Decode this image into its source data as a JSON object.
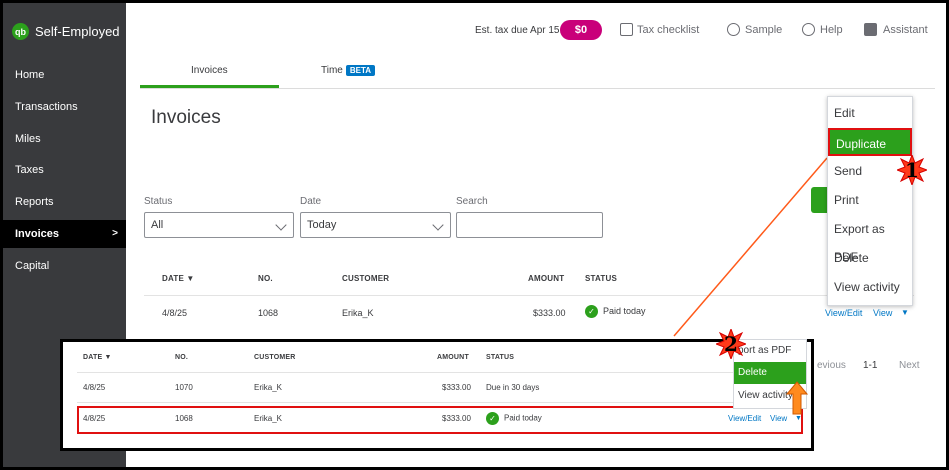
{
  "sidebar": {
    "brand": "Self-Employed",
    "logo_text": "qb",
    "items": [
      {
        "label": "Home"
      },
      {
        "label": "Transactions"
      },
      {
        "label": "Miles"
      },
      {
        "label": "Taxes"
      },
      {
        "label": "Reports"
      },
      {
        "label": "Invoices",
        "active": true
      },
      {
        "label": "Capital"
      }
    ],
    "active_chevron": ">"
  },
  "topbar": {
    "est_tax_label": "Est. tax due Apr 15:",
    "est_tax_value": "$0",
    "tax_checklist": "Tax checklist",
    "sample": "Sample",
    "help": "Help",
    "assistant": "Assistant"
  },
  "tabs": {
    "invoices": "Invoices",
    "time": "Time",
    "beta": "BETA"
  },
  "page": {
    "title": "Invoices",
    "filters": {
      "status_label": "Status",
      "status_value": "All",
      "date_label": "Date",
      "date_value": "Today",
      "search_label": "Search",
      "search_value": ""
    }
  },
  "table": {
    "headers": {
      "date": "DATE ▼",
      "no": "NO.",
      "customer": "CUSTOMER",
      "amount": "AMOUNT",
      "status": "STATUS"
    },
    "rows": [
      {
        "date": "4/8/25",
        "no": "1068",
        "customer": "Erika_K",
        "amount": "$333.00",
        "status": "Paid today",
        "action_edit": "View/Edit",
        "action_view": "View",
        "action_caret": "▼"
      }
    ]
  },
  "pagination": {
    "previous": "evious",
    "range": "1-1",
    "next": "Next"
  },
  "menu": {
    "items": [
      "Edit",
      "Duplicate",
      "Send",
      "Print",
      "Export as PDF",
      "Delete",
      "View activity"
    ],
    "highlighted": "Duplicate"
  },
  "inset": {
    "headers": {
      "date": "DATE ▼",
      "no": "NO.",
      "customer": "CUSTOMER",
      "amount": "AMOUNT",
      "status": "STATUS"
    },
    "rows": [
      {
        "date": "4/8/25",
        "no": "1070",
        "customer": "Erika_K",
        "amount": "$333.00",
        "status": "Due in 30 days"
      },
      {
        "date": "4/8/25",
        "no": "1068",
        "customer": "Erika_K",
        "amount": "$333.00",
        "status": "Paid today",
        "action_edit": "View/Edit",
        "action_view": "View",
        "action_caret": "▼"
      }
    ],
    "menu": {
      "export": "port as PDF",
      "delete": "Delete",
      "activity": "View activity"
    }
  },
  "callouts": {
    "one": "1",
    "two": "2"
  },
  "colors": {
    "brand_green": "#2ca01c",
    "tax_pill": "#c9007a",
    "link_blue": "#0077c5",
    "sidebar": "#393a3d",
    "callout_red": "#e01010",
    "callout_fill": "#ff3a1a",
    "arrow_orange": "#ff8a1e"
  }
}
